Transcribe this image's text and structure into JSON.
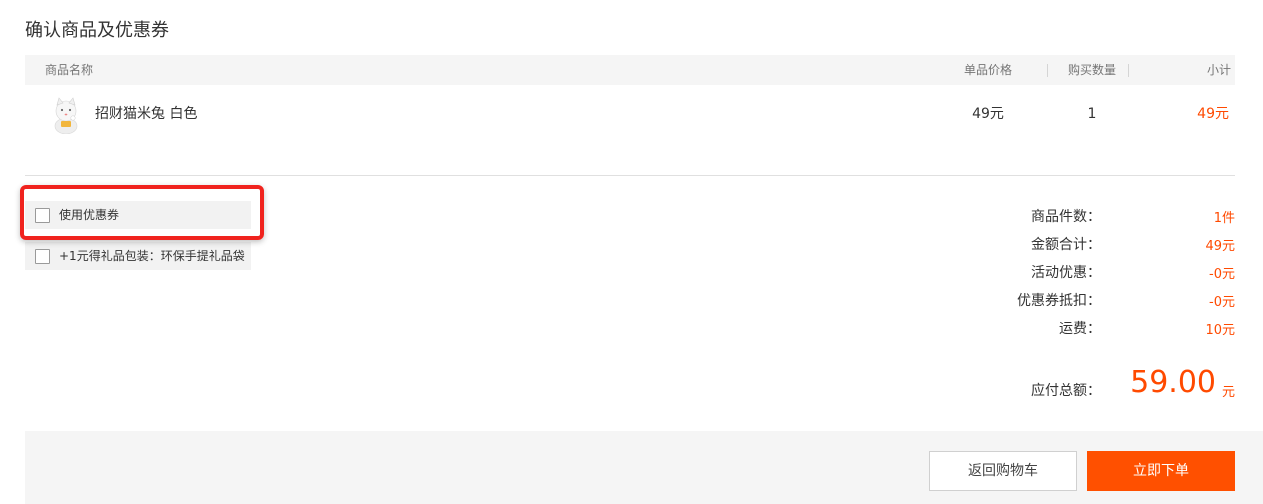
{
  "page": {
    "title": "确认商品及优惠券"
  },
  "table": {
    "headers": {
      "name": "商品名称",
      "price": "单品价格",
      "quantity": "购买数量",
      "subtotal": "小计"
    },
    "items": [
      {
        "name": "招财猫米兔 白色",
        "price": "49元",
        "quantity": "1",
        "subtotal": "49元",
        "thumbnail_icon": "lucky-cat-figure"
      }
    ]
  },
  "options": {
    "coupon": {
      "label": "使用优惠券",
      "checked": false
    },
    "gift_wrap": {
      "label": "+1元得礼品包装：环保手提礼品袋",
      "checked": false
    }
  },
  "summary": {
    "item_count_label": "商品件数：",
    "item_count_value": "1件",
    "amount_total_label": "金额合计：",
    "amount_total_value": "49元",
    "promotion_label": "活动优惠：",
    "promotion_value": "-0元",
    "coupon_deduct_label": "优惠券抵扣：",
    "coupon_deduct_value": "-0元",
    "shipping_label": "运费：",
    "shipping_value": "10元",
    "payable_label": "应付总额：",
    "payable_amount": "59.00",
    "payable_unit": "元"
  },
  "actions": {
    "back_label": "返回购物车",
    "submit_label": "立即下单"
  },
  "colors": {
    "accent": "#ff5000",
    "price": "#ff4a00",
    "highlight": "#f0231e"
  }
}
